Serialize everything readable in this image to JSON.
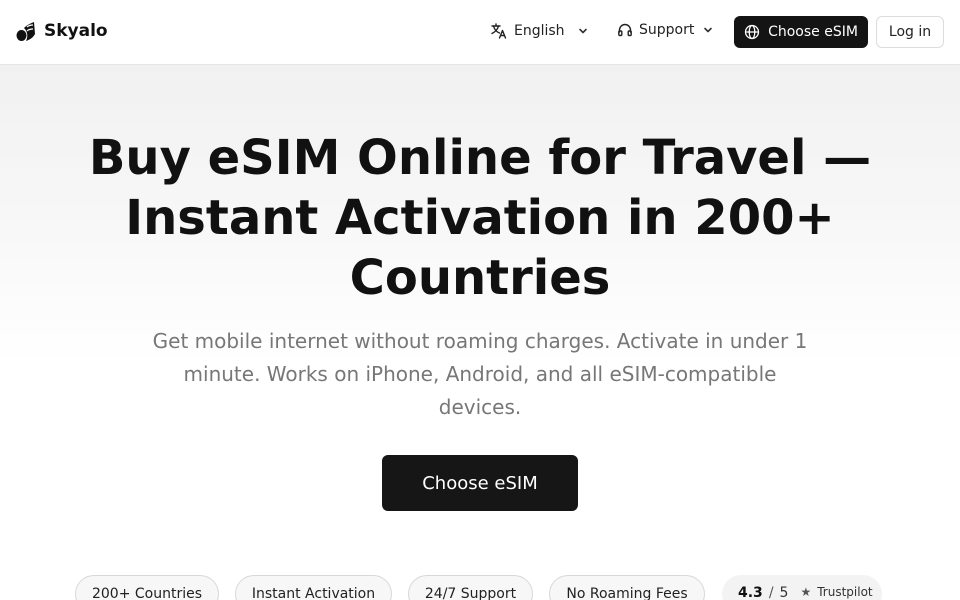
{
  "header": {
    "brand_name": "Skyalo",
    "language_label": "English",
    "support_label": "Support",
    "choose_esim_label": "Choose eSIM",
    "login_label": "Log in"
  },
  "hero": {
    "title": "Buy eSIM Online for Travel — Instant Activation in 200+ Countries",
    "subtitle": "Get mobile internet without roaming charges. Activate in under 1 minute. Works on iPhone, Android, and all eSIM-compatible devices.",
    "cta_label": "Choose eSIM"
  },
  "features": [
    {
      "label": "200+ Countries"
    },
    {
      "label": "Instant Activation"
    },
    {
      "label": "24/7 Support"
    },
    {
      "label": "No Roaming Fees"
    }
  ],
  "rating": {
    "value": "4.3",
    "separator": "/",
    "max": "5",
    "star_glyph": "★",
    "source": "Trustpilot"
  },
  "icons": {
    "logo": "signal-logo-icon",
    "language": "translate-icon",
    "support": "headset-icon",
    "chevron": "chevron-down-icon",
    "globe": "globe-icon",
    "star": "star-icon"
  },
  "colors": {
    "primary_button": "#141414",
    "text": "#111111",
    "muted_text": "#777777",
    "pill_border": "#d8d8d8"
  }
}
